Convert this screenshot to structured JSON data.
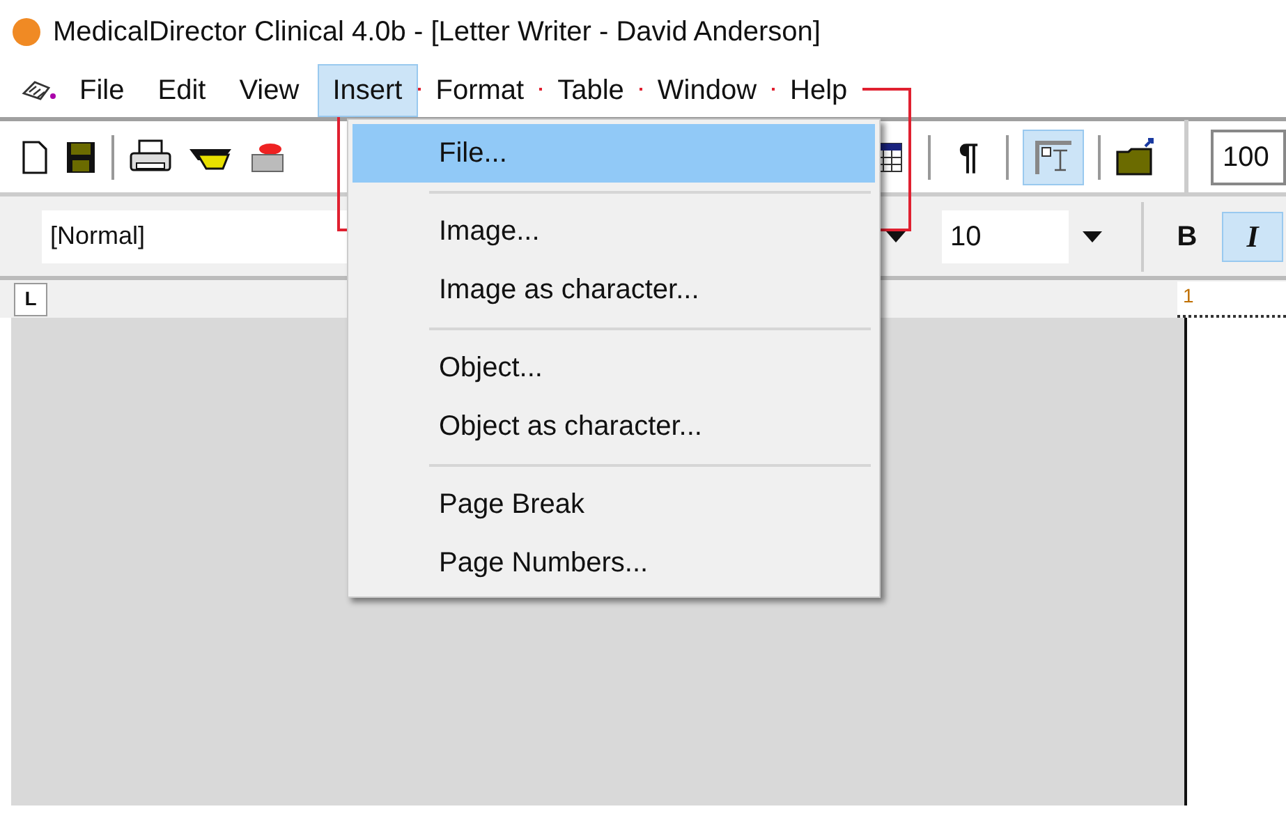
{
  "window": {
    "title": "MedicalDirector Clinical 4.0b - [Letter Writer - David Anderson]"
  },
  "menu_bar": [
    {
      "label": "File",
      "selected": false
    },
    {
      "label": "Edit",
      "selected": false
    },
    {
      "label": "View",
      "selected": false
    },
    {
      "label": "Insert",
      "selected": true
    },
    {
      "label": "Format",
      "selected": false
    },
    {
      "label": "Table",
      "selected": false
    },
    {
      "label": "Window",
      "selected": false
    },
    {
      "label": "Help",
      "selected": false
    }
  ],
  "toolbar": {
    "pilcrow": "¶",
    "frame_button": {
      "selected": true
    },
    "zoom": {
      "value": "100"
    }
  },
  "format_bar": {
    "style": {
      "value": "[Normal]"
    },
    "font_size": {
      "value": "10"
    },
    "bold": {
      "label": "B",
      "selected": false
    },
    "italic": {
      "label": "I",
      "selected": true
    }
  },
  "ruler": {
    "tab_button": "L",
    "marker": "1"
  },
  "insert_menu": {
    "items": [
      {
        "kind": "item",
        "label": "File...",
        "selected": true
      },
      {
        "kind": "separator"
      },
      {
        "kind": "item",
        "label": "Image...",
        "selected": false
      },
      {
        "kind": "item",
        "label": "Image as character...",
        "selected": false
      },
      {
        "kind": "separator"
      },
      {
        "kind": "item",
        "label": "Object...",
        "selected": false
      },
      {
        "kind": "item",
        "label": "Object as character...",
        "selected": false
      },
      {
        "kind": "separator"
      },
      {
        "kind": "item",
        "label": "Page Break",
        "selected": false
      },
      {
        "kind": "item",
        "label": "Page Numbers...",
        "selected": false
      }
    ]
  }
}
